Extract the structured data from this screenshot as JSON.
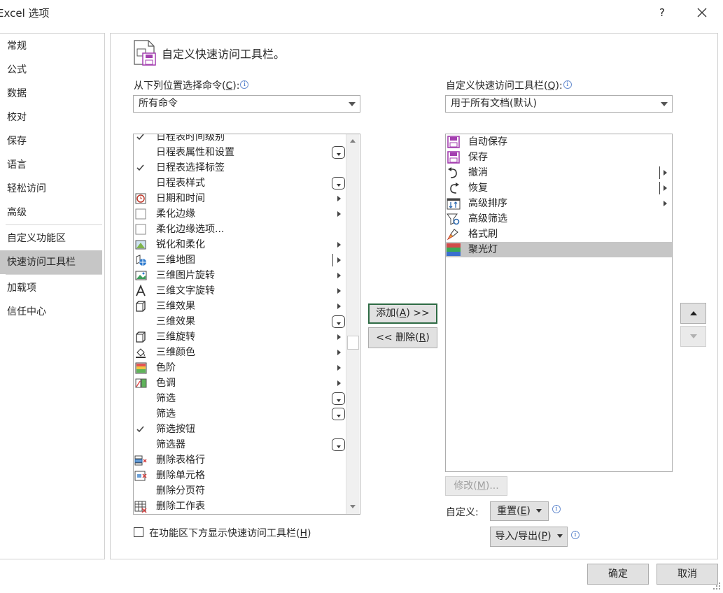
{
  "window": {
    "title": "Excel 选项",
    "help": "?",
    "close_icon": "close-icon"
  },
  "nav": {
    "items": [
      "常规",
      "公式",
      "数据",
      "校对",
      "保存",
      "语言",
      "轻松访问",
      "高级",
      "自定义功能区",
      "快速访问工具栏",
      "加载项",
      "信任中心"
    ],
    "active": "快速访问工具栏"
  },
  "main": {
    "heading": "自定义快速访问工具栏。",
    "left_label": "从下列位置选择命令(",
    "left_label_key": "C",
    "left_label_end": "):",
    "left_select": "所有命令",
    "right_label": "自定义快速访问工具栏(",
    "right_label_key": "Q",
    "right_label_end": "):",
    "right_select": "用于所有文档(默认)",
    "commands": [
      {
        "label": "日程表时间级别",
        "icon": "check-icon",
        "tail": ""
      },
      {
        "label": "日程表属性和设置",
        "icon": "",
        "tail": "drop"
      },
      {
        "label": "日程表选择标签",
        "icon": "check-icon",
        "tail": ""
      },
      {
        "label": "日程表样式",
        "icon": "",
        "tail": "drop"
      },
      {
        "label": "日期和时间",
        "icon": "clock-icon",
        "tail": "sub"
      },
      {
        "label": "柔化边缘",
        "icon": "square-icon",
        "tail": "sub"
      },
      {
        "label": "柔化边缘选项...",
        "icon": "square-icon",
        "tail": ""
      },
      {
        "label": "锐化和柔化",
        "icon": "sharpen-icon",
        "tail": "sub"
      },
      {
        "label": "三维地图",
        "icon": "globe-icon",
        "tail": "barsub"
      },
      {
        "label": "三维图片旋转",
        "icon": "picture-icon",
        "tail": "sub"
      },
      {
        "label": "三维文字旋转",
        "icon": "text-a-icon",
        "tail": "sub"
      },
      {
        "label": "三维效果",
        "icon": "cube-icon",
        "tail": "sub"
      },
      {
        "label": "三维效果",
        "icon": "",
        "tail": "drop"
      },
      {
        "label": "三维旋转",
        "icon": "cube-icon",
        "tail": "sub"
      },
      {
        "label": "三维颜色",
        "icon": "paint-bucket-icon",
        "tail": "sub"
      },
      {
        "label": "色阶",
        "icon": "color-scale-icon",
        "tail": "sub"
      },
      {
        "label": "色调",
        "icon": "color-tone-icon",
        "tail": "sub"
      },
      {
        "label": "筛选",
        "icon": "",
        "tail": "drop"
      },
      {
        "label": "筛选",
        "icon": "",
        "tail": "drop"
      },
      {
        "label": "筛选按钮",
        "icon": "check-icon",
        "tail": ""
      },
      {
        "label": "筛选器",
        "icon": "",
        "tail": "drop"
      },
      {
        "label": "删除表格行",
        "icon": "delete-row-icon",
        "tail": ""
      },
      {
        "label": "删除单元格",
        "icon": "delete-cell-icon",
        "tail": ""
      },
      {
        "label": "删除分页符",
        "icon": "",
        "tail": ""
      },
      {
        "label": "删除工作表",
        "icon": "delete-sheet-icon",
        "tail": ""
      }
    ],
    "add_label": "添加(",
    "add_key": "A",
    "add_end": ") >>",
    "remove_label": "<< 删除(",
    "remove_key": "R",
    "remove_end": ")",
    "toolbar_items": [
      {
        "label": "自动保存",
        "icon": "save-icon",
        "tail": ""
      },
      {
        "label": "保存",
        "icon": "save-icon",
        "tail": ""
      },
      {
        "label": "撤消",
        "icon": "undo-icon",
        "tail": "barsub"
      },
      {
        "label": "恢复",
        "icon": "redo-icon",
        "tail": "barsub"
      },
      {
        "label": "高级排序",
        "icon": "sort-icon",
        "tail": "sub"
      },
      {
        "label": "高级筛选",
        "icon": "filter-icon",
        "tail": ""
      },
      {
        "label": "格式刷",
        "icon": "format-painter-icon",
        "tail": ""
      },
      {
        "label": "聚光灯",
        "icon": "spotlight-icon",
        "tail": "",
        "selected": true
      }
    ],
    "modify_label": "修改(",
    "modify_key": "M",
    "modify_end": ")...",
    "customize_label": "自定义:",
    "reset_label": "重置(",
    "reset_key": "E",
    "reset_end": ")",
    "import_label": "导入/导出(",
    "import_key": "P",
    "import_end": ")",
    "checkbox_label": "在功能区下方显示快速访问工具栏(",
    "checkbox_key": "H",
    "checkbox_end": ")",
    "info_glyph": "i"
  },
  "footer": {
    "ok": "确定",
    "cancel": "取消"
  },
  "colors": {
    "accent_border": "#2e6b44",
    "selected_bg": "#c6c6c6",
    "save_icon": "#a43fb0"
  }
}
